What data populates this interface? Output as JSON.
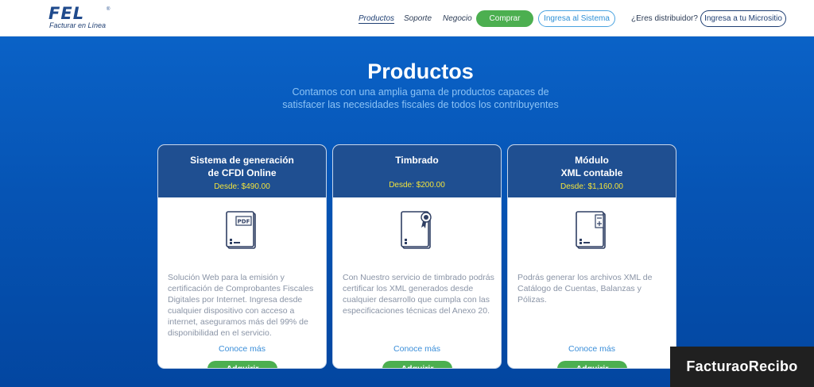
{
  "brand": {
    "logo_text": "FEL",
    "logo_reg": "®",
    "tagline": "Facturar en Línea"
  },
  "nav": {
    "productos": "Productos",
    "soporte": "Soporte",
    "negocio": "Negocio",
    "comprar": "Comprar",
    "ingresa_sistema": "Ingresa al Sistema",
    "distribuidor": "¿Eres distribuidor?",
    "micrositio": "Ingresa a tu Micrositio"
  },
  "hero": {
    "title": "Productos",
    "subtitle_line1": "Contamos con una amplia gama de productos capaces de",
    "subtitle_line2": "satisfacer las necesidades fiscales de todos los contribuyentes"
  },
  "cards": [
    {
      "title_line1": "Sistema de generación",
      "title_line2": "de CFDI Online",
      "price": "Desde: $490.00",
      "icon": "pdf-document-icon",
      "description": "Solución Web para la emisión y certificación de Comprobantes Fiscales Digitales por Internet. Ingresa desde cualquier dispositivo con acceso a internet, aseguramos más del 99% de disponibilidad en el servicio.",
      "more": "Conoce más",
      "buy": "Adquirir"
    },
    {
      "title_line1": "Timbrado",
      "title_line2": "",
      "price": "Desde: $200.00",
      "icon": "certified-document-icon",
      "description": "Con Nuestro servicio de timbrado podrás certificar los XML generados desde cualquier desarrollo que cumpla con las especificaciones técnicas del Anexo 20.",
      "more": "Conoce más",
      "buy": "Adquirir"
    },
    {
      "title_line1": "Módulo",
      "title_line2": "XML contable",
      "price": "Desde: $1,160.00",
      "icon": "accounting-document-icon",
      "description": "Podrás generar los archivos XML de Catálogo de Cuentas, Balanzas y Pólizas.",
      "more": "Conoce más",
      "buy": "Adquirir"
    }
  ],
  "watermark": "FacturaoRecibo",
  "colors": {
    "header_bg": "#ffffff",
    "hero_bg": "#0654b4",
    "card_head": "#1f4f91",
    "price": "#f2e33c",
    "accent_green": "#4caf50",
    "link_blue": "#3a8ed9"
  }
}
